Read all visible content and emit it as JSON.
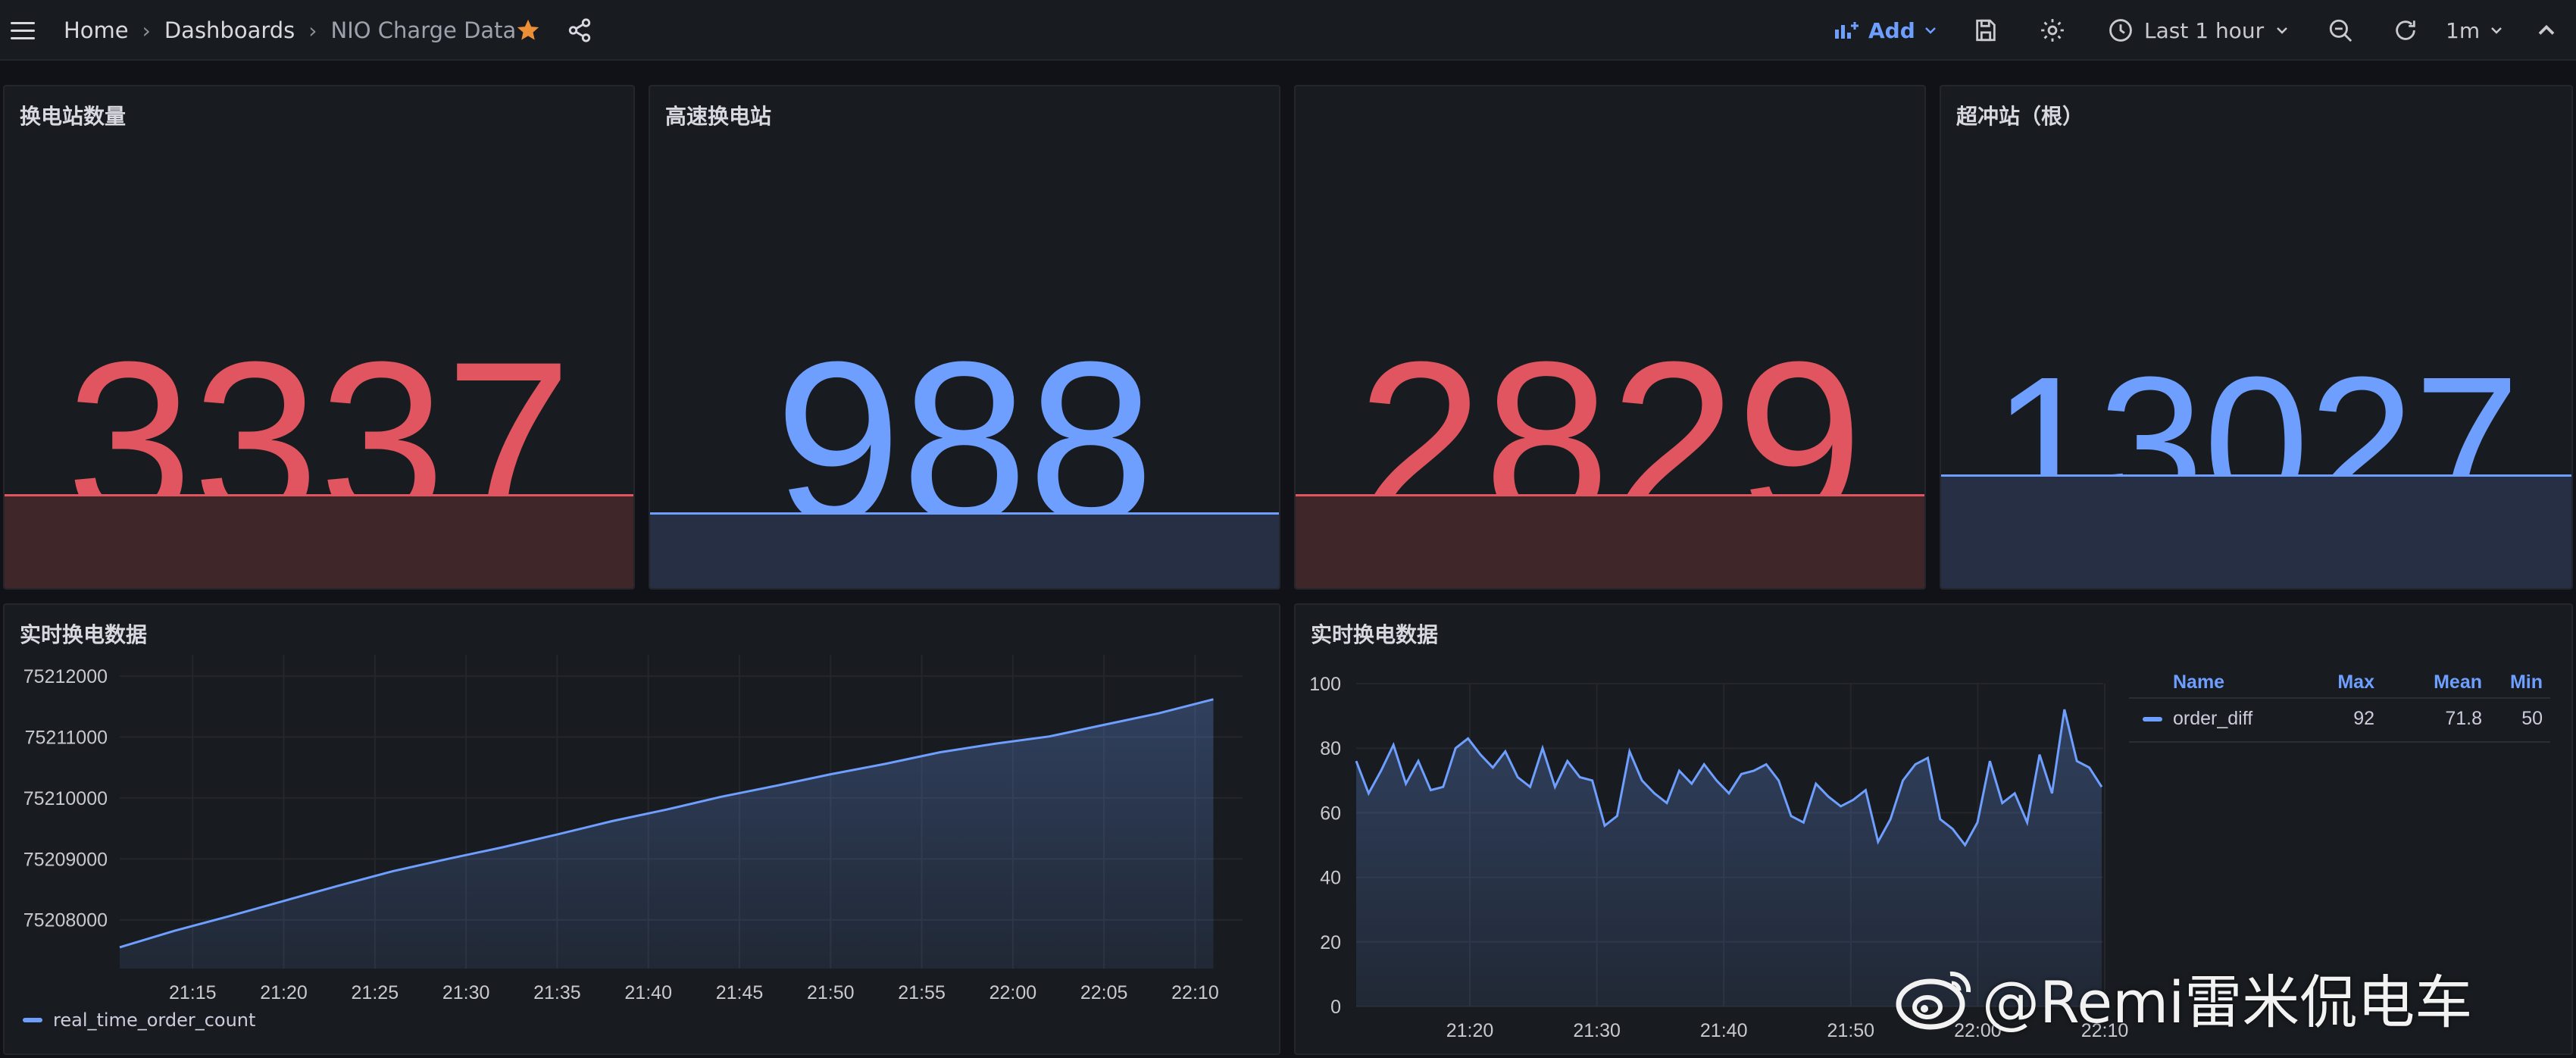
{
  "header": {
    "breadcrumb": [
      "Home",
      "Dashboards",
      "NIO Charge Data"
    ],
    "add_label": "Add",
    "time_range": "Last 1 hour",
    "refresh_interval": "1m"
  },
  "stats": [
    {
      "title": "换电站数量",
      "value": "3337",
      "color": "#e0555f",
      "fill": "#3f2629",
      "line": "#e0555f"
    },
    {
      "title": "高速换电站",
      "value": "988",
      "color": "#6e9fff",
      "fill": "#262f43",
      "line": "#6e9fff"
    },
    {
      "title": "",
      "value": "2829",
      "color": "#e0555f",
      "fill": "#3f2629",
      "line": "#e0555f"
    },
    {
      "title": "超冲站（根）",
      "value": "13027",
      "color": "#6e9fff",
      "fill": "#262f43",
      "line": "#6e9fff"
    }
  ],
  "panels": {
    "left_title": "实时换电数据",
    "right_title": "实时换电数据",
    "left_legend": "real_time_order_count",
    "right_legend": {
      "headers": [
        "Name",
        "Max",
        "Mean",
        "Min"
      ],
      "row": [
        "order_diff",
        "92",
        "71.8",
        "50"
      ]
    }
  },
  "chart_data": [
    {
      "type": "area",
      "title": "实时换电数据",
      "xlabel": "",
      "ylabel": "",
      "x_ticks": [
        "21:15",
        "21:20",
        "21:25",
        "21:30",
        "21:35",
        "21:40",
        "21:45",
        "21:50",
        "21:55",
        "22:00",
        "22:05",
        "22:10"
      ],
      "y_ticks": [
        75208000,
        75209000,
        75210000,
        75211000,
        75212000
      ],
      "x_range_minutes": [
        21.1,
        22.2
      ],
      "ylim": [
        75207200,
        75212350
      ],
      "series": [
        {
          "name": "real_time_order_count",
          "color": "#6e9fff",
          "x": [
            "21:11",
            "21:14",
            "21:17",
            "21:20",
            "21:23",
            "21:26",
            "21:29",
            "21:32",
            "21:35",
            "21:38",
            "21:41",
            "21:44",
            "21:47",
            "21:50",
            "21:53",
            "21:56",
            "21:59",
            "22:02",
            "22:05",
            "22:08",
            "22:11"
          ],
          "y": [
            75207550,
            75207820,
            75208060,
            75208310,
            75208560,
            75208800,
            75209000,
            75209190,
            75209400,
            75209620,
            75209810,
            75210020,
            75210200,
            75210390,
            75210560,
            75210750,
            75210890,
            75211010,
            75211200,
            75211390,
            75211620
          ]
        }
      ],
      "grid": true,
      "legend": "bottom-left"
    },
    {
      "type": "area",
      "title": "实时换电数据",
      "xlabel": "",
      "ylabel": "",
      "x_ticks": [
        "21:20",
        "21:30",
        "21:40",
        "21:50",
        "22:00",
        "22:10"
      ],
      "y_ticks": [
        0,
        20,
        40,
        60,
        80,
        100
      ],
      "ylim": [
        0,
        100
      ],
      "series": [
        {
          "name": "order_diff",
          "color": "#6e9fff",
          "y": [
            76,
            66,
            73,
            81,
            69,
            76,
            67,
            68,
            80,
            83,
            78,
            74,
            79,
            71,
            68,
            80,
            68,
            76,
            71,
            70,
            56,
            59,
            79,
            70,
            66,
            63,
            73,
            69,
            75,
            70,
            66,
            72,
            73,
            75,
            70,
            59,
            57,
            69,
            65,
            62,
            64,
            67,
            51,
            58,
            70,
            75,
            77,
            58,
            55,
            50,
            57,
            76,
            63,
            66,
            57,
            78,
            66,
            92,
            76,
            74,
            68
          ],
          "stats": {
            "max": 92,
            "mean": 71.8,
            "min": 50
          }
        }
      ],
      "grid": true,
      "legend": "right-table"
    }
  ],
  "watermark": "@Remi雷米侃电车"
}
